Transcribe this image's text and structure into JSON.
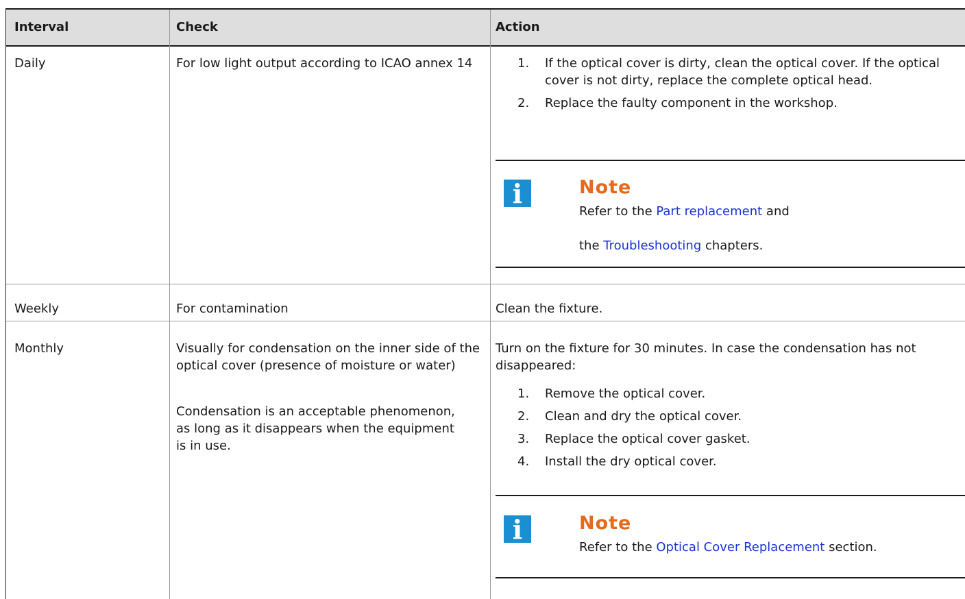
{
  "table": {
    "headers": {
      "interval": "Interval",
      "check": "Check",
      "action": "Action"
    },
    "rows": [
      {
        "interval": "Daily",
        "check": "For low light output according to ICAO annex 14",
        "action": {
          "steps": [
            "If the optical cover is dirty, clean the optical cover. If the optical cover is not dirty, replace the complete optical head.",
            "Replace the faulty component in the workshop."
          ],
          "note": {
            "title": "Note",
            "line1_pre": "Refer to the ",
            "line1_link": "Part replacement",
            "line1_post": " and",
            "line2_pre": "the ",
            "line2_link": "Troubleshooting",
            "line2_post": " chapters."
          }
        }
      },
      {
        "interval": "Weekly",
        "check": "For contamination",
        "action": {
          "text": "Clean the fixture."
        }
      },
      {
        "interval": "Monthly",
        "check": "Visually for condensation on the inner side of the optical cover (presence of moisture or water)",
        "check2": "Condensation is an acceptable phenomenon, as long as it disappears when the equipment is in use.",
        "action": {
          "intro": "Turn on the fixture for 30 minutes. In case the condensation has not disappeared:",
          "steps": [
            "Remove the optical cover.",
            "Clean and dry the optical cover.",
            "Replace the optical cover gasket.",
            "Install the dry optical cover."
          ],
          "note": {
            "title": "Note",
            "line1_pre": "Refer to the ",
            "line1_link": "Optical Cover Replacement",
            "line1_post": " section."
          }
        }
      }
    ],
    "step_numbers": [
      "1.",
      "2.",
      "3.",
      "4."
    ],
    "icon": "info-icon",
    "colors": {
      "note_title": "#e56a1e",
      "icon_bg": "#1a8fd1",
      "link": "#1a33d6",
      "header_bg": "#dedede"
    }
  }
}
